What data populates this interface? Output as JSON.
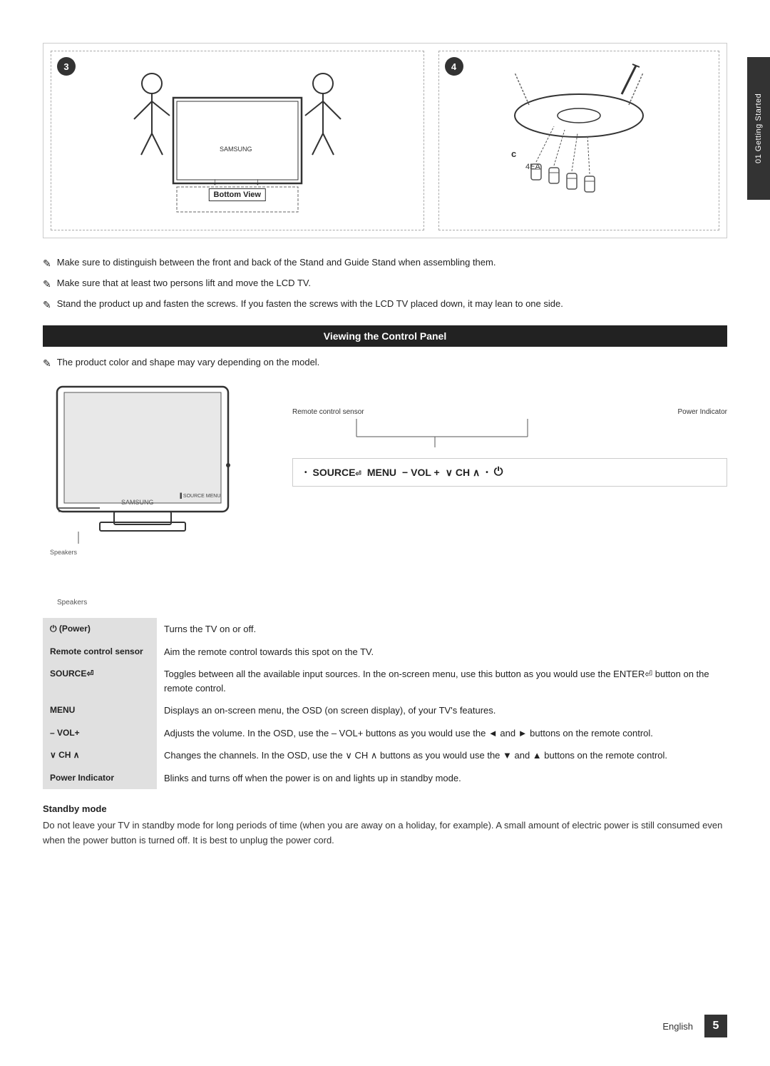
{
  "sidebar": {
    "label": "01 Getting Started"
  },
  "steps": {
    "step3_label": "3",
    "step4_label": "4",
    "bottom_view_label": "Bottom View",
    "item_c_label": "c",
    "item_4ea_label": "4EA"
  },
  "notes": {
    "note1": "Make sure to distinguish between the front and back of the Stand and Guide Stand when assembling them.",
    "note2": "Make sure that at least two persons lift and move the LCD TV.",
    "note3": "Stand the product up and fasten the screws. If you fasten the screws with the LCD TV placed down, it may lean to one side."
  },
  "section": {
    "title": "Viewing the Control Panel"
  },
  "model_note": "The product color and shape may vary depending on the model.",
  "control_panel": {
    "remote_sensor_label": "Remote control sensor",
    "power_indicator_label": "Power Indicator",
    "speakers_label": "Speakers",
    "button_bar": "• SOURCE⏎ MENU – VOL + ∨ CH ∧ • ⏻"
  },
  "features": [
    {
      "key": "⏻ (Power)",
      "value": "Turns the TV on or off."
    },
    {
      "key": "Remote control sensor",
      "value": "Aim the remote control towards this spot on the TV."
    },
    {
      "key": "SOURCE⏎",
      "value": "Toggles between all the available input sources. In the on-screen menu, use this button as you would use the ENTER⏎ button on the remote control."
    },
    {
      "key": "MENU",
      "value": "Displays an on-screen menu, the OSD (on screen display), of your TV's features."
    },
    {
      "key": "– VOL+",
      "value": "Adjusts the volume. In the OSD, use the – VOL+ buttons as you would use the ◄ and ► buttons on the remote control."
    },
    {
      "key": "∨ CH ∧",
      "value": "Changes the channels. In the OSD, use the ∨ CH ∧ buttons as you would use the ▼ and ▲ buttons on the remote control."
    },
    {
      "key": "Power Indicator",
      "value": "Blinks and turns off when the power is on and lights up in standby mode."
    }
  ],
  "standby": {
    "title": "Standby mode",
    "text": "Do not leave your TV in standby mode for long periods of time (when you are away on a holiday, for example). A small amount of electric power is still consumed even when the power button is turned off. It is best to unplug the power cord."
  },
  "footer": {
    "lang": "English",
    "page_num": "5"
  }
}
